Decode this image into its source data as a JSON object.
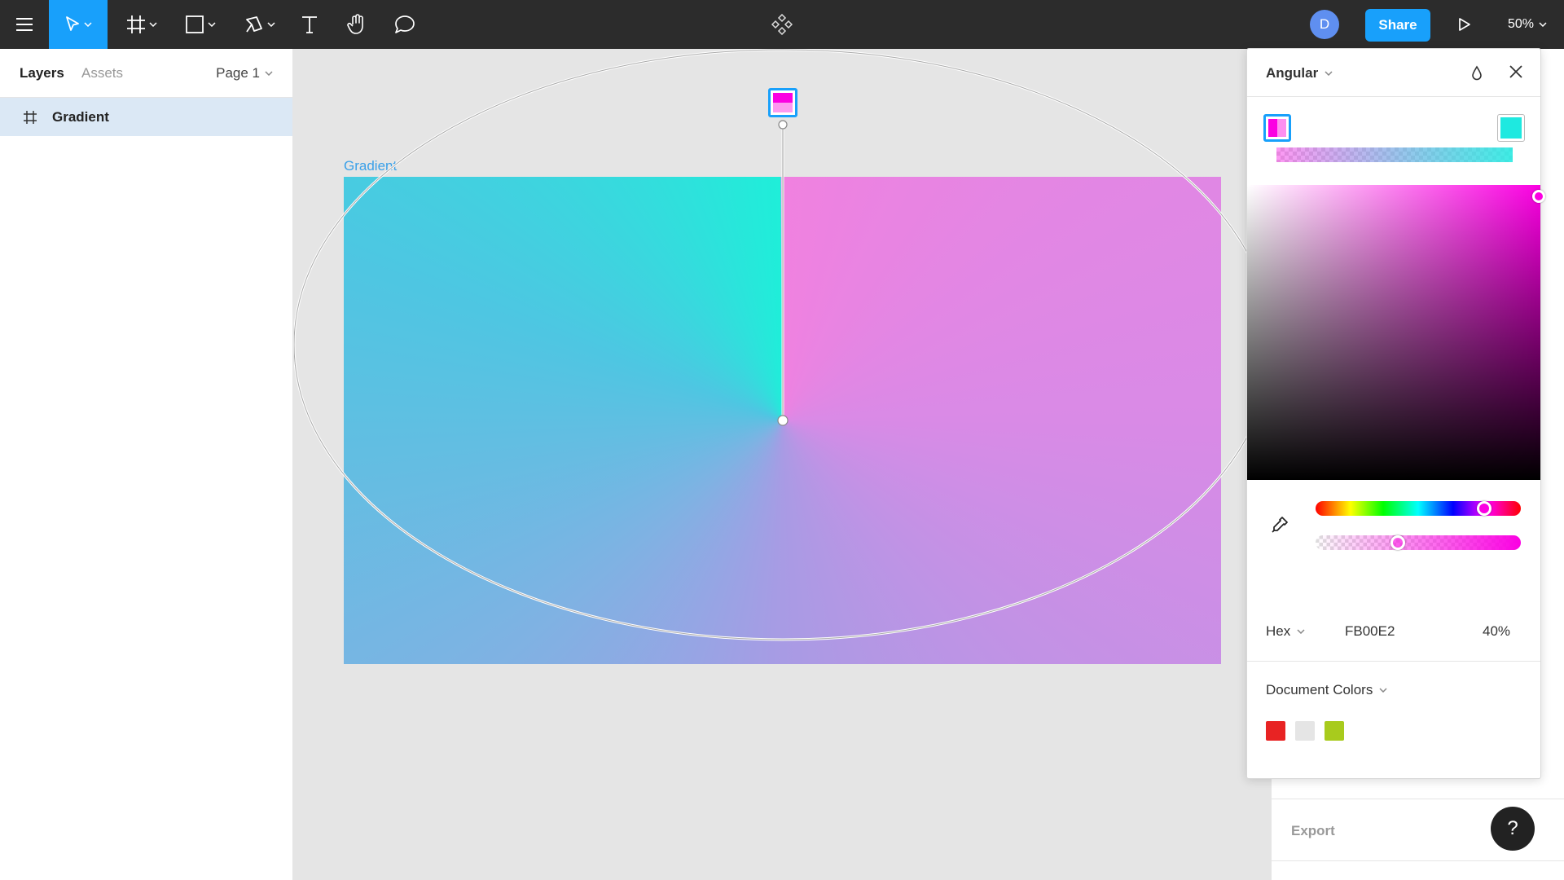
{
  "toolbar": {
    "avatar_initial": "D",
    "share_label": "Share",
    "zoom_label": "50%",
    "icons": [
      "menu-icon",
      "move-tool-icon",
      "frame-tool-icon",
      "rectangle-tool-icon",
      "pen-tool-icon",
      "text-tool-icon",
      "hand-tool-icon",
      "comment-tool-icon",
      "components-icon",
      "present-icon"
    ]
  },
  "left_panel": {
    "tabs": {
      "layers": "Layers",
      "assets": "Assets"
    },
    "page_label": "Page 1",
    "layers": [
      {
        "icon": "frame-icon",
        "name": "Gradient"
      }
    ]
  },
  "canvas": {
    "frame_label": "Gradient"
  },
  "picker": {
    "gradient_type": "Angular",
    "stops": [
      "#FB00E2",
      "#1EE9E0"
    ],
    "color_mode": "Hex",
    "hex_value": "FB00E2",
    "alpha": "40%",
    "document_colors_label": "Document Colors",
    "document_colors": [
      "#E82323",
      "#E5E5E5",
      "#A8CB1D"
    ]
  },
  "right_panel": {
    "export_label": "Export"
  },
  "help_label": "?"
}
